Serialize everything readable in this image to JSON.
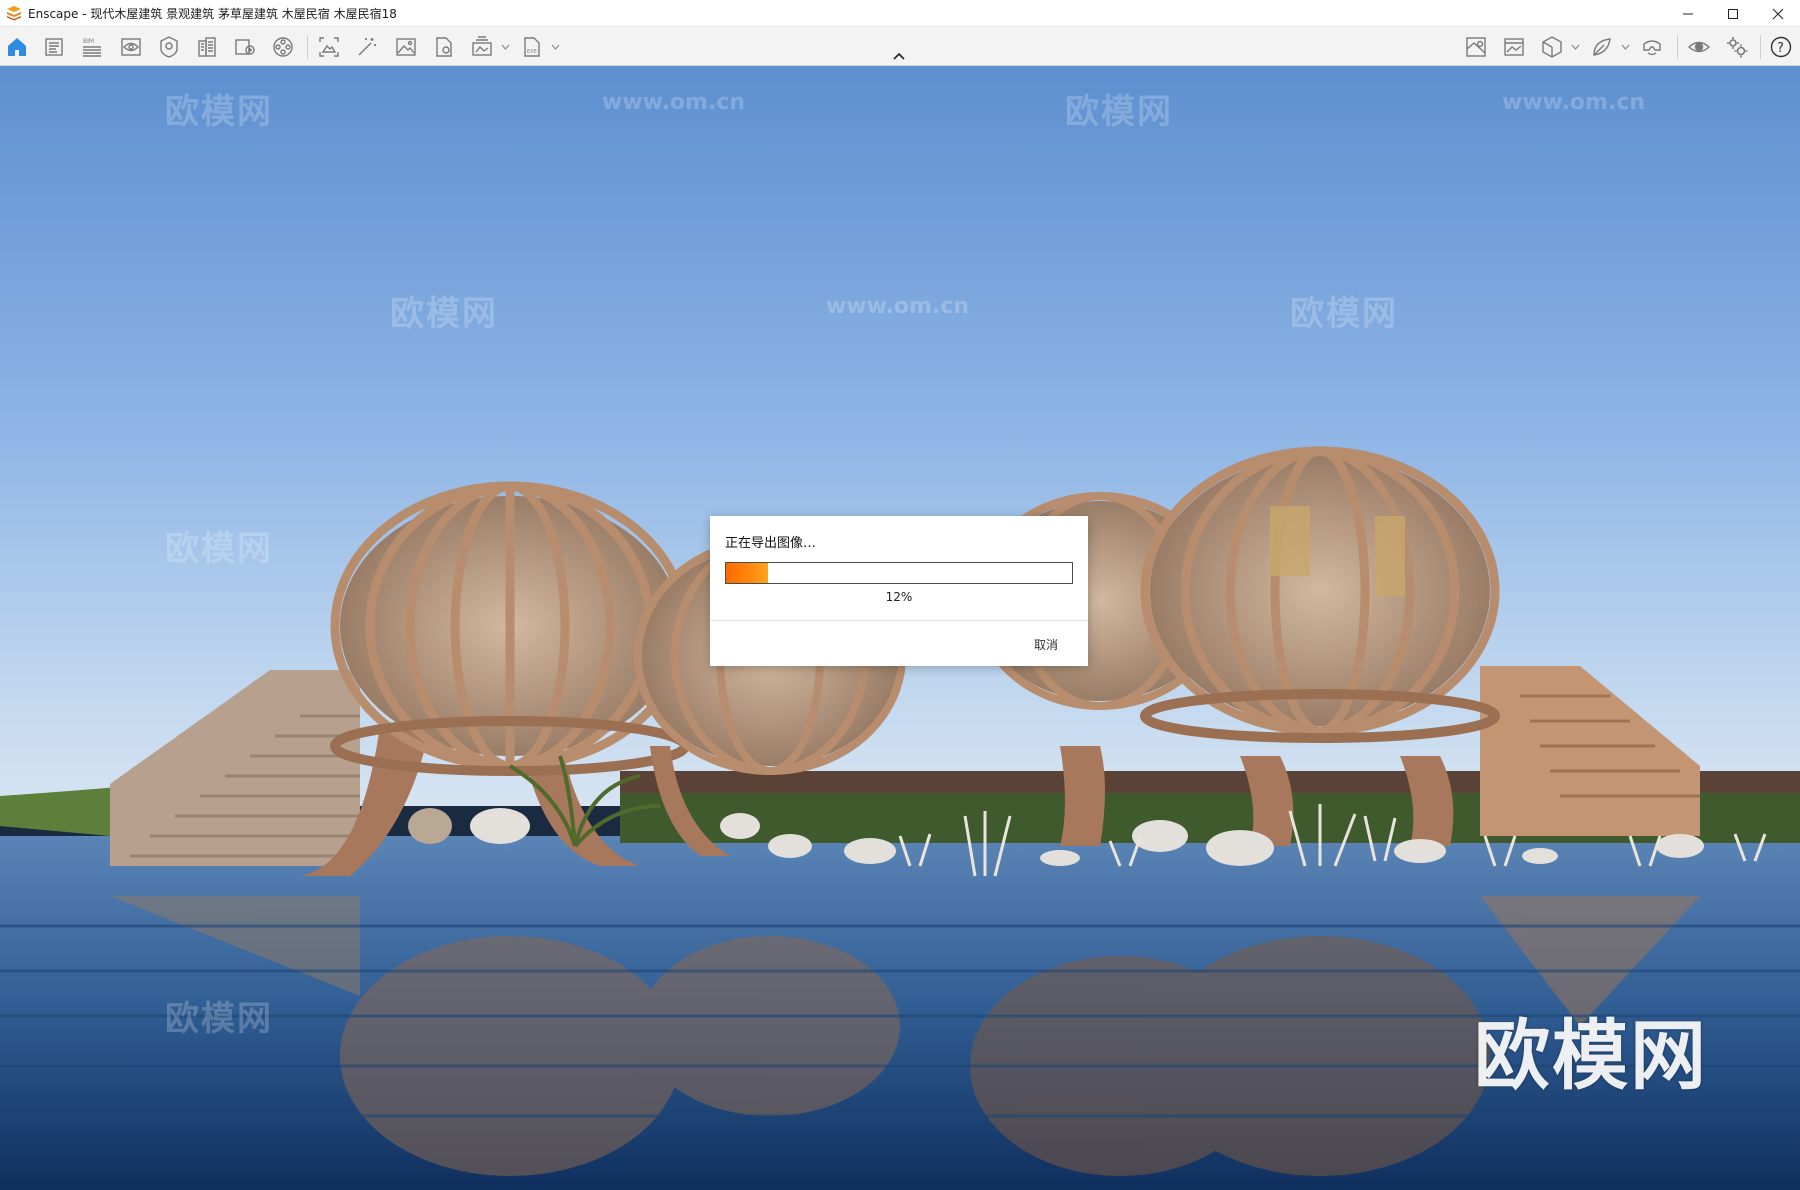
{
  "window": {
    "title": "Enscape - 现代木屋建筑 景观建筑 茅草屋建筑 木屋民宿 木屋民宿18",
    "brand_color": "#f39c12"
  },
  "toolbar": {
    "accent_color": "#2f8ce0",
    "left_icons": [
      "home-icon",
      "document-icon",
      "bim-icon",
      "view-icon",
      "asset-icon",
      "building-icon",
      "export-icon",
      "video-icon"
    ],
    "middle_icons": [
      "screenshot-icon",
      "magic-wand-icon",
      "image-icon",
      "file-export-icon",
      "batch-render-icon",
      "exe-export-icon"
    ],
    "right_icons": [
      "map-icon",
      "gallery-icon",
      "cube-icon",
      "leaf-icon",
      "vr-headset-icon",
      "visual-settings-icon",
      "settings-icon",
      "help-icon"
    ]
  },
  "viewport": {
    "watermark_cn": "欧模网",
    "watermark_url": "www.om.cn",
    "watermark_big": "欧模网"
  },
  "dialog": {
    "title": "正在导出图像…",
    "progress_fraction": 0.12,
    "progress_text": "12%",
    "cancel_label": "取消",
    "progress_color": "#ff7a0a"
  }
}
